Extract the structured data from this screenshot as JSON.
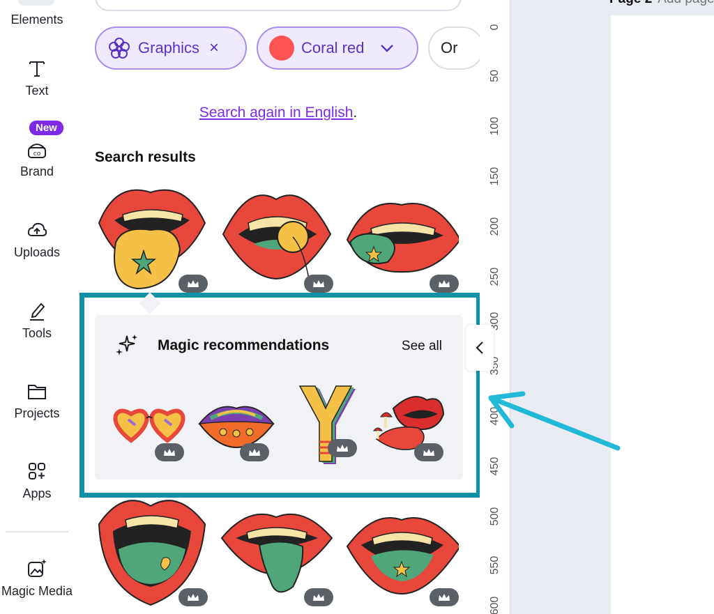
{
  "sidebar": {
    "items": [
      {
        "label": "Elements"
      },
      {
        "label": "Text"
      },
      {
        "label": "Brand",
        "badge": "New"
      },
      {
        "label": "Uploads"
      },
      {
        "label": "Tools"
      },
      {
        "label": "Projects"
      },
      {
        "label": "Apps"
      },
      {
        "label": "Magic Media"
      }
    ]
  },
  "filters": {
    "chips": [
      {
        "label": "Graphics",
        "icon": "flower-icon",
        "action": "×"
      },
      {
        "label": "Coral red",
        "color": "#ff5252",
        "action": "⌄"
      },
      {
        "label": "Or"
      }
    ]
  },
  "search_again": {
    "link_text": "Search again in English",
    "suffix": "."
  },
  "results": {
    "title": "Search results"
  },
  "magic": {
    "title": "Magic recommendations",
    "see_all": "See all"
  },
  "ruler": {
    "ticks": [
      "0",
      "50",
      "100",
      "150",
      "200",
      "250",
      "300",
      "350",
      "400",
      "450",
      "500",
      "550",
      "600"
    ]
  },
  "page": {
    "label": "Page 2",
    "add_title": "Add page title"
  },
  "colors": {
    "accent": "#7d2ae8",
    "highlight": "#1191a5",
    "arrow": "#22b8d8",
    "lips_red": "#e8473b"
  }
}
